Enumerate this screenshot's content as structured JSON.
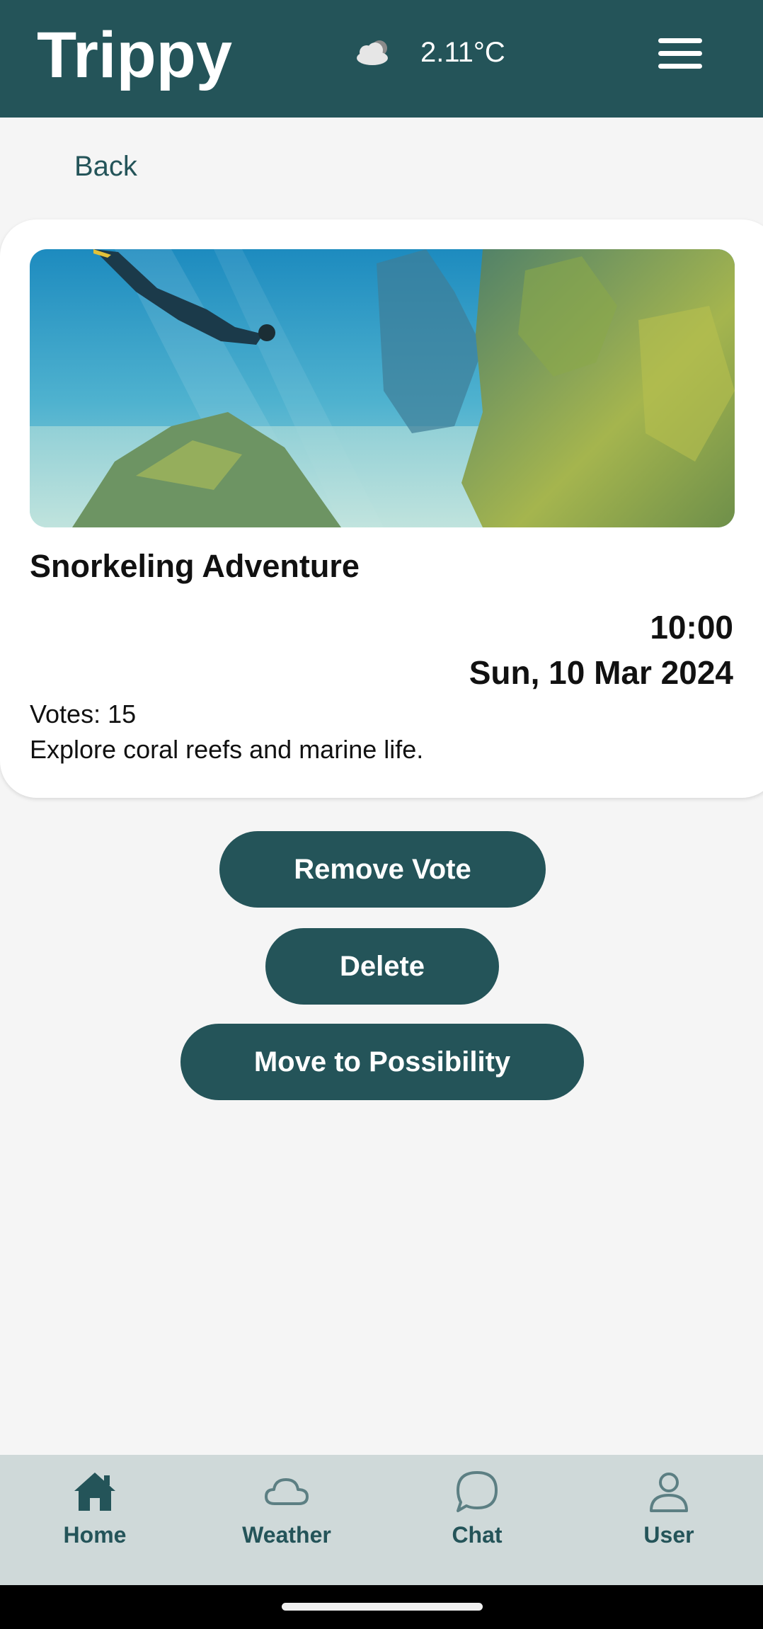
{
  "header": {
    "title": "Trippy",
    "weather_icon": "cloud-icon",
    "temperature": "2.11°C",
    "menu_icon": "hamburger-menu-icon"
  },
  "back": {
    "label": "Back"
  },
  "activity": {
    "image_icon": "snorkeling-photo",
    "title": "Snorkeling Adventure",
    "time": "10:00",
    "date": "Sun, 10 Mar 2024",
    "votes_label": "Votes: 15",
    "description": "Explore coral reefs and marine life."
  },
  "actions": {
    "remove_vote": "Remove Vote",
    "delete": "Delete",
    "move": "Move to Possibility"
  },
  "bottom_nav": {
    "items": [
      {
        "label": "Home",
        "icon": "home-icon"
      },
      {
        "label": "Weather",
        "icon": "cloud-icon"
      },
      {
        "label": "Chat",
        "icon": "chat-bubble-icon"
      },
      {
        "label": "User",
        "icon": "user-icon"
      }
    ]
  },
  "colors": {
    "primary": "#245459",
    "background": "#f5f5f5",
    "nav_background": "#cfd9d9"
  }
}
